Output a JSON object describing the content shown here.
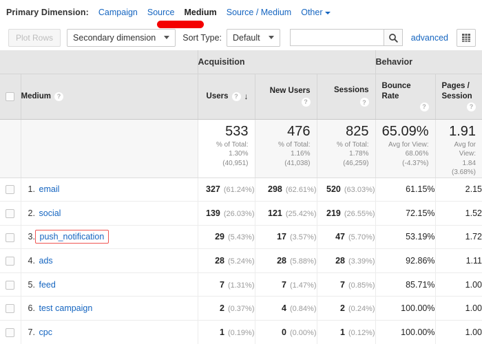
{
  "primary_dimension": {
    "label": "Primary Dimension:",
    "links": [
      "Campaign",
      "Source",
      "Medium",
      "Source / Medium"
    ],
    "active": "Medium",
    "other_label": "Other",
    "other_icon": "chevron-down-icon"
  },
  "toolbar": {
    "plot_rows_label": "Plot Rows",
    "secondary_dimension_label": "Secondary dimension",
    "sort_type_label": "Sort Type:",
    "sort_type_value": "Default",
    "search_value": "",
    "search_placeholder": "",
    "search_icon": "search-icon",
    "advanced_label": "advanced",
    "grid_view_icon": "grid-view-icon"
  },
  "table": {
    "groups": [
      {
        "label": "Acquisition"
      },
      {
        "label": "Behavior"
      }
    ],
    "dimension_header": "Medium",
    "help_icon": "help-icon",
    "sort_icon": "sort-descending-arrow",
    "columns": [
      {
        "label": "Users",
        "sorted": true
      },
      {
        "label": "New Users",
        "sorted": false
      },
      {
        "label": "Sessions",
        "sorted": false
      },
      {
        "label": "Bounce Rate",
        "sorted": false
      },
      {
        "label": "Pages / Session",
        "sorted": false
      }
    ],
    "summary": [
      {
        "value": "533",
        "line1": "% of Total:",
        "line2": "1.30%",
        "line3": "(40,951)"
      },
      {
        "value": "476",
        "line1": "% of Total:",
        "line2": "1.16%",
        "line3": "(41,038)"
      },
      {
        "value": "825",
        "line1": "% of Total:",
        "line2": "1.78%",
        "line3": "(46,259)"
      },
      {
        "value": "65.09%",
        "line1": "Avg for View:",
        "line2": "68.06%",
        "line3": "(-4.37%)"
      },
      {
        "value": "1.91",
        "line1": "Avg for View:",
        "line2": "1.84",
        "line3": "(3.68%)"
      }
    ],
    "rows": [
      {
        "index": "1.",
        "label": "email",
        "highlighted": false,
        "users": "327",
        "users_pct": "(61.24%)",
        "new_users": "298",
        "new_users_pct": "(62.61%)",
        "sessions": "520",
        "sessions_pct": "(63.03%)",
        "bounce_rate": "61.15%",
        "pages_session": "2.15"
      },
      {
        "index": "2.",
        "label": "social",
        "highlighted": false,
        "users": "139",
        "users_pct": "(26.03%)",
        "new_users": "121",
        "new_users_pct": "(25.42%)",
        "sessions": "219",
        "sessions_pct": "(26.55%)",
        "bounce_rate": "72.15%",
        "pages_session": "1.52"
      },
      {
        "index": "3.",
        "label": "push_notification",
        "highlighted": true,
        "users": "29",
        "users_pct": "(5.43%)",
        "new_users": "17",
        "new_users_pct": "(3.57%)",
        "sessions": "47",
        "sessions_pct": "(5.70%)",
        "bounce_rate": "53.19%",
        "pages_session": "1.72"
      },
      {
        "index": "4.",
        "label": "ads",
        "highlighted": false,
        "users": "28",
        "users_pct": "(5.24%)",
        "new_users": "28",
        "new_users_pct": "(5.88%)",
        "sessions": "28",
        "sessions_pct": "(3.39%)",
        "bounce_rate": "92.86%",
        "pages_session": "1.11"
      },
      {
        "index": "5.",
        "label": "feed",
        "highlighted": false,
        "users": "7",
        "users_pct": "(1.31%)",
        "new_users": "7",
        "new_users_pct": "(1.47%)",
        "sessions": "7",
        "sessions_pct": "(0.85%)",
        "bounce_rate": "85.71%",
        "pages_session": "1.00"
      },
      {
        "index": "6.",
        "label": "test campaign",
        "highlighted": false,
        "users": "2",
        "users_pct": "(0.37%)",
        "new_users": "4",
        "new_users_pct": "(0.84%)",
        "sessions": "2",
        "sessions_pct": "(0.24%)",
        "bounce_rate": "100.00%",
        "pages_session": "1.00"
      },
      {
        "index": "7.",
        "label": "cpc",
        "highlighted": false,
        "users": "1",
        "users_pct": "(0.19%)",
        "new_users": "0",
        "new_users_pct": "(0.00%)",
        "sessions": "1",
        "sessions_pct": "(0.12%)",
        "bounce_rate": "100.00%",
        "pages_session": "1.00"
      }
    ]
  },
  "annotations": {
    "marker_color": "#f40000",
    "highlight_box_color": "#ef5350"
  },
  "colors": {
    "link": "#1565c0",
    "header_bg": "#e6e6e6",
    "summary_bg": "#f7f7f7"
  }
}
